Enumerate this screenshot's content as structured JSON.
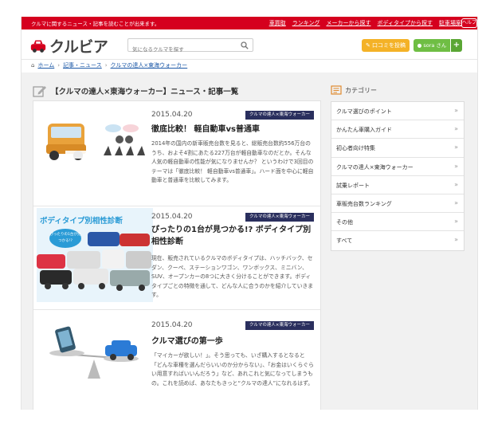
{
  "topbar": {
    "tagline": "クルマに関するニュース・記事を読むことが出来ます。",
    "nav": [
      "車買取",
      "ランキング",
      "メーカーから探す",
      "ボディタイプから探す",
      "駐車場案",
      "ヘルプ"
    ]
  },
  "header": {
    "logo_text": "クルビア",
    "search_placeholder": "気になるクルマを探す",
    "kuchikomi_label": "口コミを投稿",
    "user_label": "sora さん",
    "plus_label": "+"
  },
  "breadcrumb": {
    "home": "ホーム",
    "news": "記事・ニュース",
    "current": "クルマの達人×東海ウォーカー",
    "sep": "›"
  },
  "main": {
    "heading": "【クルマの達人×東海ウォーカー】ニュース・記事一覧",
    "articles": [
      {
        "date": "2015.04.20",
        "tag": "クルマの達人×東海ウォーカー",
        "title": "徹底比較！ 軽自動車vs普通車",
        "body": "2014年の国内の新車販売台数を見ると、総販売台数約556万台のうち、およそ4割にあたる227万台が軽自動車なのだとか。そんな人気の軽自動車の性能が気になりませんか？ というわけで3回目のテーマは「徹底比較！ 軽自動車vs普通車」。ハード面を中心に軽自動車と普通車を比較してみます。"
      },
      {
        "date": "2015.04.20",
        "tag": "クルマの達人×東海ウォーカー",
        "title": "ぴったりの1台が見つかる!? ボディタイプ別相性診断",
        "thumb_title": "ボディタイプ別相性診断",
        "thumb_bubble": "ぴったりの1台が見つかる!?",
        "body": "現在、販売されているクルマのボディタイプは、ハッチバック、セダン、クーペ、ステーションワゴン、ワンボックス、ミニバン、SUV、オープンカーの8つに大きく分けることができます。ボディタイプごとの特徴を通して、どんな人に合うのかを紹介していきます。"
      },
      {
        "date": "2015.04.20",
        "tag": "クルマの達人×東海ウォーカー",
        "title": "クルマ選びの第一歩",
        "body": "「マイカーが欲しい！」。そう思っても、いざ購入するとなると「どんな車種を選んだらいいのか分からない」、「お金はいくらぐらい用意すればいいんだろう」など、あれこれと気になってしまうもの。これを読めば、あなたもきっと“クルマの達人”になれるはず。"
      }
    ]
  },
  "sidebar": {
    "heading": "カテゴリー",
    "items": [
      "クルマ選びのポイント",
      "かんたん車購入ガイド",
      "初心者向け特集",
      "クルマの達人×東海ウォーカー",
      "試乗レポート",
      "車販売台数ランキング",
      "その他",
      "すべて"
    ],
    "chevron": "»"
  },
  "colors": {
    "brand_red": "#d5001e",
    "tag_navy": "#2a2f5e",
    "kuchikomi_yellow": "#f4b227",
    "user_green": "#6fbe44",
    "link_blue": "#1e5aa8"
  }
}
